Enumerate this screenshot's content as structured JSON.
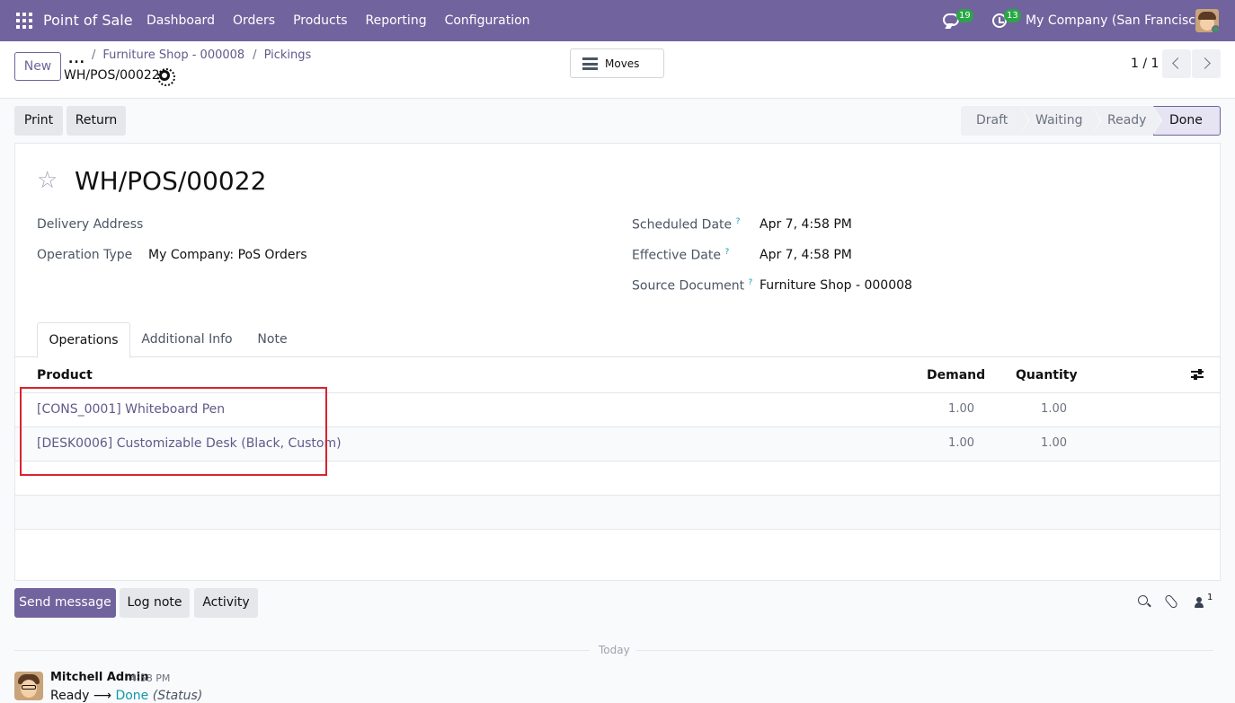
{
  "navbar": {
    "app_name": "Point of Sale",
    "menu": [
      "Dashboard",
      "Orders",
      "Products",
      "Reporting",
      "Configuration"
    ],
    "messages_count": "19",
    "activities_count": "13",
    "company": "My Company (San Francisco)"
  },
  "control": {
    "new_label": "New",
    "more_label": "...",
    "breadcrumb": [
      {
        "label": "Furniture Shop - 000008"
      },
      {
        "label": "Pickings"
      }
    ],
    "breadcrumb_sep": "/",
    "record_name": "WH/POS/00022",
    "moves_label": "Moves",
    "pager": "1 / 1"
  },
  "actions": {
    "print_label": "Print",
    "return_label": "Return"
  },
  "statusbar": {
    "stages": [
      "Draft",
      "Waiting",
      "Ready",
      "Done"
    ],
    "current": "Done"
  },
  "form": {
    "title": "WH/POS/00022",
    "delivery_address_label": "Delivery Address",
    "delivery_address_value": "",
    "operation_type_label": "Operation Type",
    "operation_type_value": "My Company: PoS Orders",
    "scheduled_date_label": "Scheduled Date",
    "scheduled_date_value": "Apr 7, 4:58 PM",
    "effective_date_label": "Effective Date",
    "effective_date_value": "Apr 7, 4:58 PM",
    "source_document_label": "Source Document",
    "source_document_value": "Furniture Shop - 000008",
    "help_mark": "?"
  },
  "tabs": [
    "Operations",
    "Additional Info",
    "Note"
  ],
  "table": {
    "columns": [
      "Product",
      "Demand",
      "Quantity"
    ],
    "rows": [
      {
        "product": "[CONS_0001] Whiteboard Pen",
        "demand": "1.00",
        "quantity": "1.00"
      },
      {
        "product": "[DESK0006] Customizable Desk (Black, Custom)",
        "demand": "1.00",
        "quantity": "1.00"
      }
    ]
  },
  "chatter": {
    "send_message_label": "Send message",
    "log_note_label": "Log note",
    "activity_label": "Activity",
    "followers_count": "1",
    "today_label": "Today",
    "message": {
      "author": "Mitchell Admin",
      "time": "4:58 PM",
      "from": "Ready",
      "arrow": "⟶",
      "to": "Done",
      "field": "(Status)"
    }
  },
  "colors": {
    "brand": "#71639e",
    "highlight_box": "#d9232e",
    "badge": "#28a745"
  }
}
